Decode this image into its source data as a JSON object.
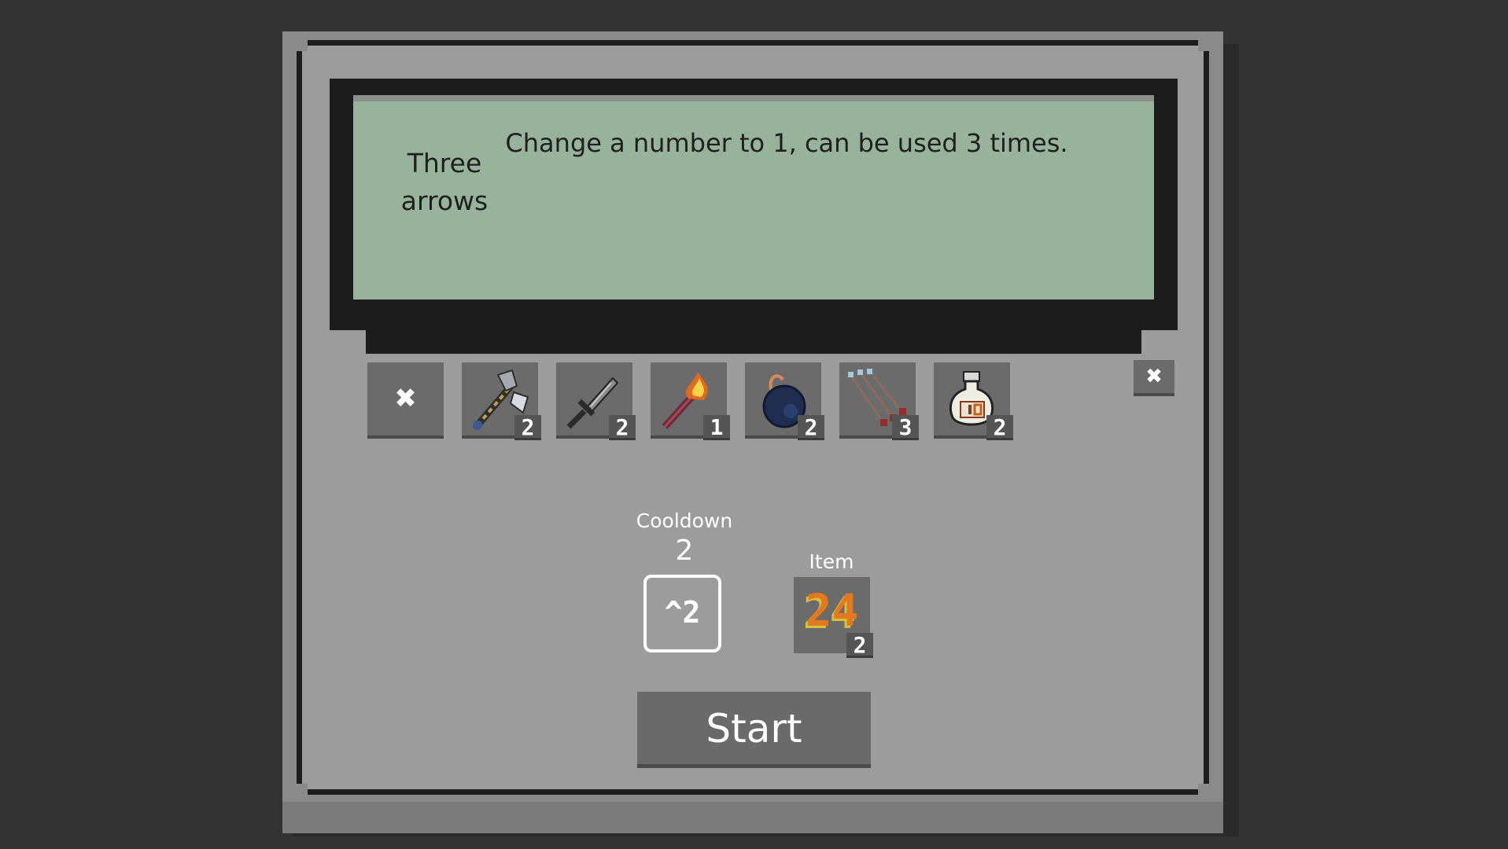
{
  "description": {
    "item_name": "Three\narrows",
    "item_text": "Change a number to 1, can be used 3 times."
  },
  "inventory": {
    "slots": [
      {
        "name": "clear",
        "icon": "x-icon",
        "label": "✖"
      },
      {
        "name": "axe",
        "icon": "battle-axe-icon",
        "count": "2"
      },
      {
        "name": "sword",
        "icon": "sword-icon",
        "count": "2"
      },
      {
        "name": "torch",
        "icon": "torch-icon",
        "count": "1"
      },
      {
        "name": "bomb",
        "icon": "bomb-icon",
        "count": "2"
      },
      {
        "name": "three-arrows",
        "icon": "arrows-icon",
        "count": "3"
      },
      {
        "name": "potion",
        "icon": "potion-icon",
        "count": "2"
      }
    ],
    "close_label": "✖"
  },
  "cooldown": {
    "label": "Cooldown",
    "value": "2",
    "power": "^2"
  },
  "item": {
    "label": "Item",
    "number": "24",
    "count": "2"
  },
  "start_label": "Start",
  "colors": {
    "background": "#333333",
    "panel": "#9c9c9c",
    "screen": "#97b39b",
    "slot": "#6b6b6b",
    "button": "#6a6a6a"
  }
}
